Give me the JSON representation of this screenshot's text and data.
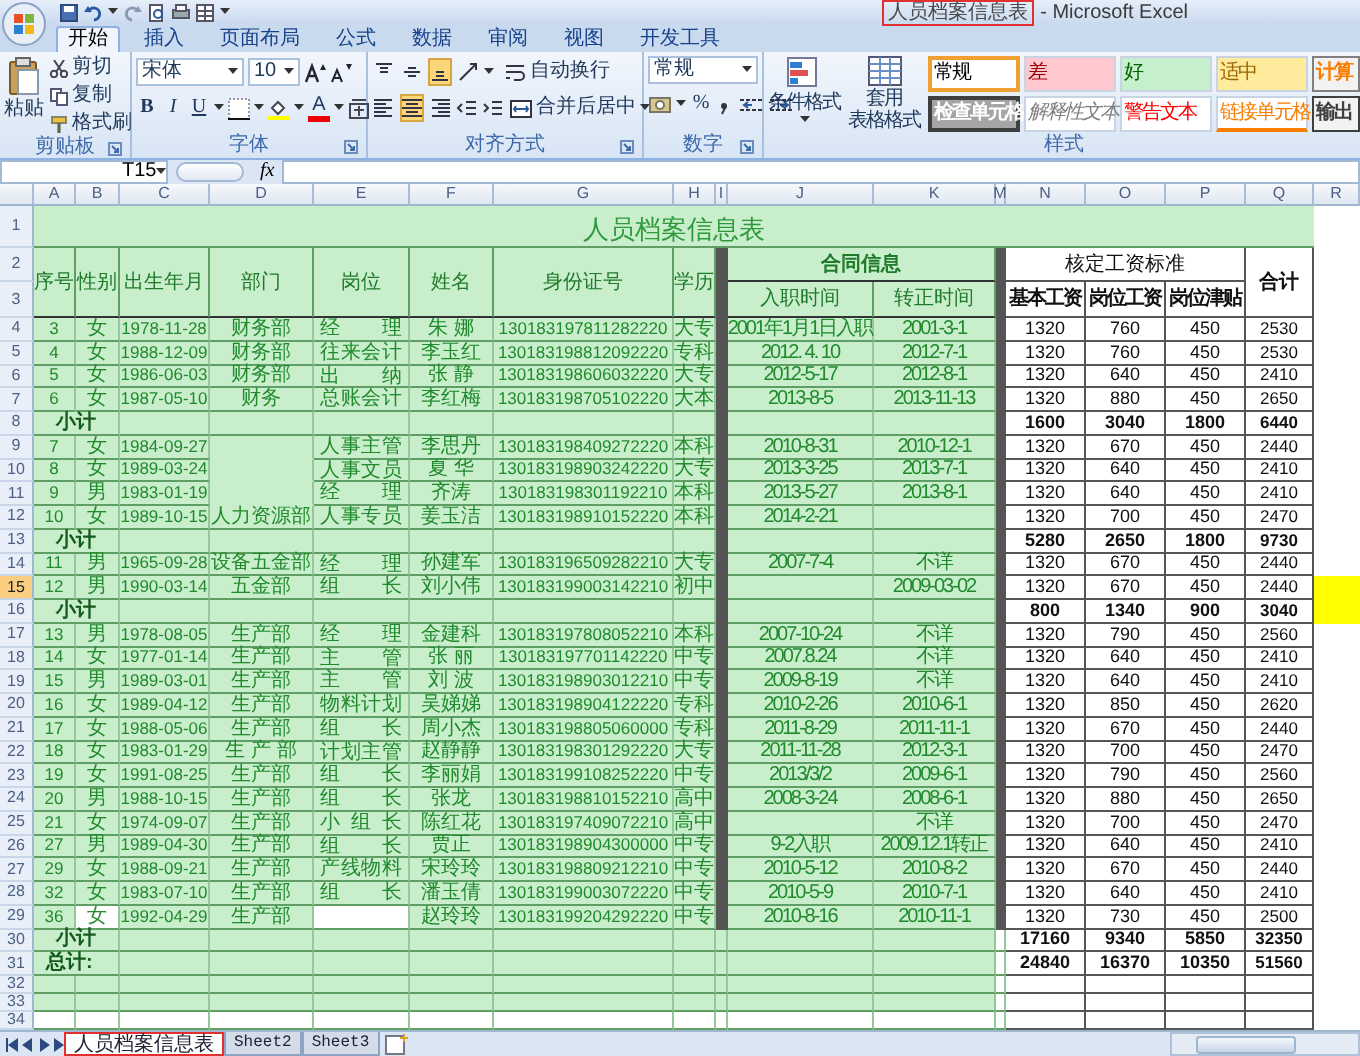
{
  "window": {
    "title": "人员档案信息表",
    "app_name": "- Microsoft Excel"
  },
  "ribbon_tabs": [
    {
      "label": "开始",
      "selected": true
    },
    {
      "label": "插入",
      "selected": false
    },
    {
      "label": "页面布局",
      "selected": false
    },
    {
      "label": "公式",
      "selected": false
    },
    {
      "label": "数据",
      "selected": false
    },
    {
      "label": "审阅",
      "selected": false
    },
    {
      "label": "视图",
      "selected": false
    },
    {
      "label": "开发工具",
      "selected": false
    }
  ],
  "clipboard": {
    "label": "剪贴板",
    "paste": "粘贴",
    "cut": "剪切",
    "copy": "复制",
    "format_painter": "格式刷"
  },
  "font": {
    "label": "字体",
    "font_name": "宋体",
    "font_size": "10",
    "style_buttons": [
      "B",
      "I",
      "U"
    ],
    "font_color": "A"
  },
  "alignment": {
    "label": "对齐方式",
    "buttons": [
      {
        "kind": "top",
        "selected": false
      },
      {
        "kind": "middle",
        "selected": false
      },
      {
        "kind": "bottom",
        "selected": true
      },
      {
        "kind": "left",
        "selected": false
      },
      {
        "kind": "center",
        "selected": true
      },
      {
        "kind": "right",
        "selected": false
      }
    ],
    "wrap_text": "自动换行",
    "merge_center": "合并后居中"
  },
  "number": {
    "label": "数字",
    "format": "常规",
    "percent": "%"
  },
  "styles": {
    "label": "样式",
    "conditional_format": "条件格式",
    "table_format": [
      "套用",
      "表格格式"
    ],
    "cell_styles": [
      {
        "label": "常规",
        "kind": "normal",
        "selected": true
      },
      {
        "label": "差",
        "kind": "bad",
        "selected": false
      },
      {
        "label": "好",
        "kind": "good",
        "selected": false
      },
      {
        "label": "适中",
        "kind": "neutral",
        "selected": false
      },
      {
        "label": "计算",
        "kind": "calculation",
        "selected": false
      },
      {
        "label": "检查单元格",
        "kind": "check",
        "selected": false
      },
      {
        "label": "解释性文本",
        "kind": "explanatory",
        "selected": false
      },
      {
        "label": "警告文本",
        "kind": "warning",
        "selected": false
      },
      {
        "label": "链接单元格",
        "kind": "linked",
        "selected": false
      },
      {
        "label": "输出",
        "kind": "output",
        "selected": false
      }
    ]
  },
  "formula_bar": {
    "cell_ref": "T15",
    "fx": "fx"
  },
  "sheet": {
    "columns": [
      "A",
      "B",
      "C",
      "D",
      "E",
      "F",
      "G",
      "H",
      "I",
      "J",
      "K",
      "M",
      "N",
      "O",
      "P",
      "Q",
      "R"
    ],
    "title": "人员档案信息表",
    "headers": {
      "seq": "序号",
      "gender": "性别",
      "birth": "出生年月",
      "dept": "部门",
      "position": "岗位",
      "name": "姓名",
      "id": "身份证号",
      "education": "学历",
      "contract": "合同信息",
      "hire_date": "入职时间",
      "regular_date": "转正时间",
      "pay_standard": "核定工资标准",
      "base_pay": "基本工资",
      "post_pay": "岗位工资",
      "allowance": "岗位津贴",
      "total": "合计"
    },
    "top_rows": [
      {
        "number": "1",
        "selected": false
      },
      {
        "number": "2",
        "selected": false
      },
      {
        "number": "3",
        "selected": false
      }
    ],
    "rows": [
      {
        "number": "4",
        "kind": "record",
        "selected": false,
        "r_highlighted": false,
        "dept_continues": false,
        "seq": "3",
        "gender": "女",
        "birth": "1978-11-28",
        "dept": "财务部",
        "position": "经 理",
        "name": "朱 娜",
        "id": "130183197811282220",
        "education": "大专",
        "hire_date": "2001年1月1日入职",
        "regular_date": "2001-3-1",
        "base_pay": "1320",
        "post_pay": "760",
        "allowance": "450",
        "total": "2530"
      },
      {
        "number": "5",
        "kind": "record",
        "selected": false,
        "r_highlighted": false,
        "dept_continues": false,
        "seq": "4",
        "gender": "女",
        "birth": "1988-12-09",
        "dept": "财务部",
        "position": "往来会计",
        "name": "李玉红",
        "id": "130183198812092220",
        "education": "专科",
        "hire_date": "2012. 4. 10",
        "regular_date": "2012-7-1",
        "base_pay": "1320",
        "post_pay": "760",
        "allowance": "450",
        "total": "2530"
      },
      {
        "number": "6",
        "kind": "record",
        "selected": false,
        "r_highlighted": false,
        "dept_continues": false,
        "seq": "5",
        "gender": "女",
        "birth": "1986-06-03",
        "dept": "财务部",
        "position": "出 纳",
        "name": "张 静",
        "id": "130183198606032220",
        "education": "大专",
        "hire_date": "2012-5-17",
        "regular_date": "2012-8-1",
        "base_pay": "1320",
        "post_pay": "640",
        "allowance": "450",
        "total": "2410"
      },
      {
        "number": "7",
        "kind": "record",
        "selected": false,
        "r_highlighted": false,
        "dept_continues": false,
        "seq": "6",
        "gender": "女",
        "birth": "1987-05-10",
        "dept": "财务",
        "position": "总账会计",
        "name": "李红梅",
        "id": "130183198705102220",
        "education": "大本",
        "hire_date": "2013-8-5",
        "regular_date": "2013-11-13",
        "base_pay": "1320",
        "post_pay": "880",
        "allowance": "450",
        "total": "2650"
      },
      {
        "number": "8",
        "kind": "subtotal",
        "selected": false,
        "r_highlighted": false,
        "label": "小计",
        "base_pay": "1600",
        "post_pay": "3040",
        "allowance": "1800",
        "total": "6440"
      },
      {
        "number": "9",
        "kind": "record",
        "selected": false,
        "r_highlighted": false,
        "dept_continues": true,
        "seq": "7",
        "gender": "女",
        "birth": "1984-09-27",
        "position": "人事主管",
        "name": "李思丹",
        "id": "130183198409272220",
        "education": "本科",
        "hire_date": "2010-8-31",
        "regular_date": "2010-12-1",
        "base_pay": "1320",
        "post_pay": "670",
        "allowance": "450",
        "total": "2440"
      },
      {
        "number": "10",
        "kind": "record",
        "selected": false,
        "r_highlighted": false,
        "dept_continues": true,
        "seq": "8",
        "gender": "女",
        "birth": "1989-03-24",
        "position": "人事文员",
        "name": "夏 华",
        "id": "130183198903242220",
        "education": "大专",
        "hire_date": "2013-3-25",
        "regular_date": "2013-7-1",
        "base_pay": "1320",
        "post_pay": "640",
        "allowance": "450",
        "total": "2410"
      },
      {
        "number": "11",
        "kind": "record",
        "selected": false,
        "r_highlighted": false,
        "dept_continues": true,
        "seq": "9",
        "gender": "男",
        "birth": "1983-01-19",
        "position": "经 理",
        "name": "齐涛",
        "id": "130183198301192210",
        "education": "本科",
        "hire_date": "2013-5-27",
        "regular_date": "2013-8-1",
        "base_pay": "1320",
        "post_pay": "640",
        "allowance": "450",
        "total": "2410"
      },
      {
        "number": "12",
        "kind": "record",
        "selected": false,
        "r_highlighted": false,
        "dept_continues": false,
        "seq": "10",
        "gender": "女",
        "birth": "1989-10-15",
        "dept": "人力资源部",
        "position": "人事专员",
        "name": "姜玉洁",
        "id": "130183198910152220",
        "education": "本科",
        "hire_date": "2014-2-21",
        "base_pay": "1320",
        "post_pay": "700",
        "allowance": "450",
        "total": "2470"
      },
      {
        "number": "13",
        "kind": "subtotal",
        "selected": false,
        "r_highlighted": false,
        "label": "小计",
        "base_pay": "5280",
        "post_pay": "2650",
        "allowance": "1800",
        "total": "9730"
      },
      {
        "number": "14",
        "kind": "record",
        "selected": false,
        "r_highlighted": false,
        "dept_continues": false,
        "seq": "11",
        "gender": "男",
        "birth": "1965-09-28",
        "dept": "设备五金部",
        "position": "经 理",
        "name": "孙建军",
        "id": "130183196509282210",
        "education": "大专",
        "hire_date": "2007-7-4",
        "regular_date": "不详",
        "base_pay": "1320",
        "post_pay": "670",
        "allowance": "450",
        "total": "2440"
      },
      {
        "number": "15",
        "kind": "record",
        "selected": true,
        "r_highlighted": true,
        "dept_continues": false,
        "seq": "12",
        "gender": "男",
        "birth": "1990-03-14",
        "dept": "五金部",
        "position": "组 长",
        "name": "刘小伟",
        "id": "130183199003142210",
        "education": "初中",
        "regular_date": "2009-03-02",
        "base_pay": "1320",
        "post_pay": "670",
        "allowance": "450",
        "total": "2440"
      },
      {
        "number": "16",
        "kind": "subtotal",
        "selected": false,
        "r_highlighted": true,
        "label": "小计",
        "base_pay": "800",
        "post_pay": "1340",
        "allowance": "900",
        "total": "3040"
      },
      {
        "number": "17",
        "kind": "record",
        "selected": false,
        "r_highlighted": false,
        "dept_continues": false,
        "seq": "13",
        "gender": "男",
        "birth": "1978-08-05",
        "dept": "生产部",
        "position": "经 理",
        "name": "金建科",
        "id": "130183197808052210",
        "education": "本科",
        "hire_date": "2007-10-24",
        "regular_date": "不详",
        "base_pay": "1320",
        "post_pay": "790",
        "allowance": "450",
        "total": "2560"
      },
      {
        "number": "18",
        "kind": "record",
        "selected": false,
        "r_highlighted": false,
        "dept_continues": false,
        "seq": "14",
        "gender": "女",
        "birth": "1977-01-14",
        "dept": "生产部",
        "position": "主 管",
        "name": "张 丽",
        "id": "130183197701142220",
        "education": "中专",
        "hire_date": "2007.8.24",
        "regular_date": "不详",
        "base_pay": "1320",
        "post_pay": "640",
        "allowance": "450",
        "total": "2410"
      },
      {
        "number": "19",
        "kind": "record",
        "selected": false,
        "r_highlighted": false,
        "dept_continues": false,
        "seq": "15",
        "gender": "男",
        "birth": "1989-03-01",
        "dept": "生产部",
        "position": "主 管",
        "name": "刘 波",
        "id": "130183198903012210",
        "education": "中专",
        "hire_date": "2009-8-19",
        "regular_date": "不详",
        "base_pay": "1320",
        "post_pay": "640",
        "allowance": "450",
        "total": "2410"
      },
      {
        "number": "20",
        "kind": "record",
        "selected": false,
        "r_highlighted": false,
        "dept_continues": false,
        "seq": "16",
        "gender": "女",
        "birth": "1989-04-12",
        "dept": "生产部",
        "position": "物料计划",
        "name": "吴娣娣",
        "id": "130183198904122220",
        "education": "专科",
        "hire_date": "2010-2-26",
        "regular_date": "2010-6-1",
        "base_pay": "1320",
        "post_pay": "850",
        "allowance": "450",
        "total": "2620"
      },
      {
        "number": "21",
        "kind": "record",
        "selected": false,
        "r_highlighted": false,
        "dept_continues": false,
        "seq": "17",
        "gender": "女",
        "birth": "1988-05-06",
        "dept": "生产部",
        "position": "组 长",
        "name": "周小杰",
        "id": "130183198805060000",
        "education": "专科",
        "hire_date": "2011-8-29",
        "regular_date": "2011-11-1",
        "base_pay": "1320",
        "post_pay": "670",
        "allowance": "450",
        "total": "2440"
      },
      {
        "number": "22",
        "kind": "record",
        "selected": false,
        "r_highlighted": false,
        "dept_continues": false,
        "seq": "18",
        "gender": "女",
        "birth": "1983-01-29",
        "dept": "生 产 部",
        "position": "计划主管",
        "name": "赵静静",
        "id": "130183198301292220",
        "education": "大专",
        "hire_date": "2011-11-28",
        "regular_date": "2012-3-1",
        "base_pay": "1320",
        "post_pay": "700",
        "allowance": "450",
        "total": "2470"
      },
      {
        "number": "23",
        "kind": "record",
        "selected": false,
        "r_highlighted": false,
        "dept_continues": false,
        "seq": "19",
        "gender": "女",
        "birth": "1991-08-25",
        "dept": "生产部",
        "position": "组 长",
        "name": "李丽娟",
        "id": "130183199108252220",
        "education": "中专",
        "hire_date": "2013/3/2",
        "regular_date": "2009-6-1",
        "base_pay": "1320",
        "post_pay": "790",
        "allowance": "450",
        "total": "2560"
      },
      {
        "number": "24",
        "kind": "record",
        "selected": false,
        "r_highlighted": false,
        "dept_continues": false,
        "seq": "20",
        "gender": "男",
        "birth": "1988-10-15",
        "dept": "生产部",
        "position": "组 长",
        "name": "张龙",
        "id": "130183198810152210",
        "education": "高中",
        "hire_date": "2008-3-24",
        "regular_date": "2008-6-1",
        "base_pay": "1320",
        "post_pay": "880",
        "allowance": "450",
        "total": "2650"
      },
      {
        "number": "25",
        "kind": "record",
        "selected": false,
        "r_highlighted": false,
        "dept_continues": false,
        "seq": "21",
        "gender": "女",
        "birth": "1974-09-07",
        "dept": "生产部",
        "position": "小 组 长",
        "name": "陈红花",
        "id": "130183197409072210",
        "education": "高中",
        "regular_date": "不详",
        "base_pay": "1320",
        "post_pay": "700",
        "allowance": "450",
        "total": "2470"
      },
      {
        "number": "26",
        "kind": "record",
        "selected": false,
        "r_highlighted": false,
        "dept_continues": false,
        "seq": "27",
        "gender": "男",
        "birth": "1989-04-30",
        "dept": "生产部",
        "position": "组 长",
        "name": "贾正",
        "id": "130183198904300000",
        "education": "中专",
        "hire_date": "9-2入职",
        "regular_date": "2009.12.1转正",
        "base_pay": "1320",
        "post_pay": "640",
        "allowance": "450",
        "total": "2410"
      },
      {
        "number": "27",
        "kind": "record",
        "selected": false,
        "r_highlighted": false,
        "dept_continues": false,
        "seq": "29",
        "gender": "女",
        "birth": "1988-09-21",
        "dept": "生产部",
        "position": "产线物料",
        "name": "宋玲玲",
        "id": "130183198809212210",
        "education": "中专",
        "hire_date": "2010-5-12",
        "regular_date": "2010-8-2",
        "base_pay": "1320",
        "post_pay": "670",
        "allowance": "450",
        "total": "2440"
      },
      {
        "number": "28",
        "kind": "record",
        "selected": false,
        "r_highlighted": false,
        "dept_continues": false,
        "seq": "32",
        "gender": "女",
        "birth": "1983-07-10",
        "dept": "生产部",
        "position": "组 长",
        "name": "潘玉倩",
        "id": "130183199003072220",
        "education": "中专",
        "hire_date": "2010-5-9",
        "regular_date": "2010-7-1",
        "base_pay": "1320",
        "post_pay": "640",
        "allowance": "450",
        "total": "2410"
      },
      {
        "number": "29",
        "kind": "record",
        "selected": false,
        "r_highlighted": false,
        "dept_continues": false,
        "gender_unfilled": true,
        "position_unfilled": true,
        "seq": "36",
        "gender": "女",
        "birth": "1992-04-29",
        "dept": "生产部",
        "name": "赵玲玲",
        "id": "130183199204292220",
        "education": "中专",
        "hire_date": "2010-8-16",
        "regular_date": "2010-11-1",
        "base_pay": "1320",
        "post_pay": "730",
        "allowance": "450",
        "total": "2500"
      },
      {
        "number": "30",
        "kind": "subtotal",
        "selected": false,
        "r_highlighted": false,
        "label": "小计",
        "base_pay": "17160",
        "post_pay": "9340",
        "allowance": "5850",
        "total": "32350"
      },
      {
        "number": "31",
        "kind": "total",
        "selected": false,
        "r_highlighted": false,
        "label": "总计:",
        "base_pay": "24840",
        "post_pay": "16370",
        "allowance": "10350",
        "total": "51560"
      }
    ],
    "bottom_rows": [
      {
        "number": "32",
        "selected": false
      },
      {
        "number": "33",
        "selected": false
      },
      {
        "number": "34",
        "selected": false
      }
    ]
  },
  "sheet_tabs": [
    {
      "label": "人员档案信息表",
      "selected": true
    },
    {
      "label": "Sheet2",
      "selected": false
    },
    {
      "label": "Sheet3",
      "selected": false
    }
  ]
}
